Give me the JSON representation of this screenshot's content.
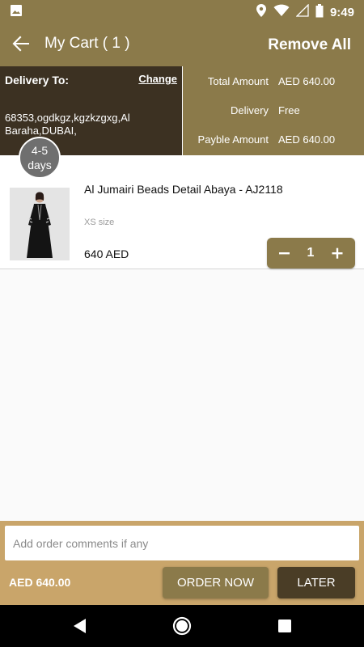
{
  "status_bar": {
    "time": "9:49",
    "icons": [
      "image-icon",
      "location-icon",
      "wifi-icon",
      "signal-icon",
      "battery-icon"
    ]
  },
  "toolbar": {
    "title": "My Cart ( 1 )",
    "remove_all_label": "Remove All",
    "back_icon": "arrow-back-icon"
  },
  "delivery": {
    "label": "Delivery To:",
    "change_label": "Change",
    "address": "68353,ogdkgz,kgzkzgxg,Al Baraha,DUBAI,",
    "eta_line1": "4-5",
    "eta_line2": "days"
  },
  "summary": {
    "rows": [
      {
        "key": "Total Amount",
        "value": "AED 640.00"
      },
      {
        "key": "Delivery",
        "value": "Free"
      },
      {
        "key": "Payble Amount",
        "value": "AED 640.00"
      }
    ]
  },
  "cart_items": [
    {
      "name": "Al Jumairi Beads Detail Abaya - AJ2118",
      "size": "XS size",
      "price": "640 AED",
      "quantity": "1"
    }
  ],
  "footer": {
    "comment_placeholder": "Add order comments if any",
    "comment_value": "",
    "total": "AED 640.00",
    "order_now_label": "ORDER NOW",
    "later_label": "LATER"
  },
  "colors": {
    "primary": "#8b7a4a",
    "dark": "#3c3122",
    "footer_bg": "#c9a56a",
    "later_bg": "#4a3d26"
  }
}
